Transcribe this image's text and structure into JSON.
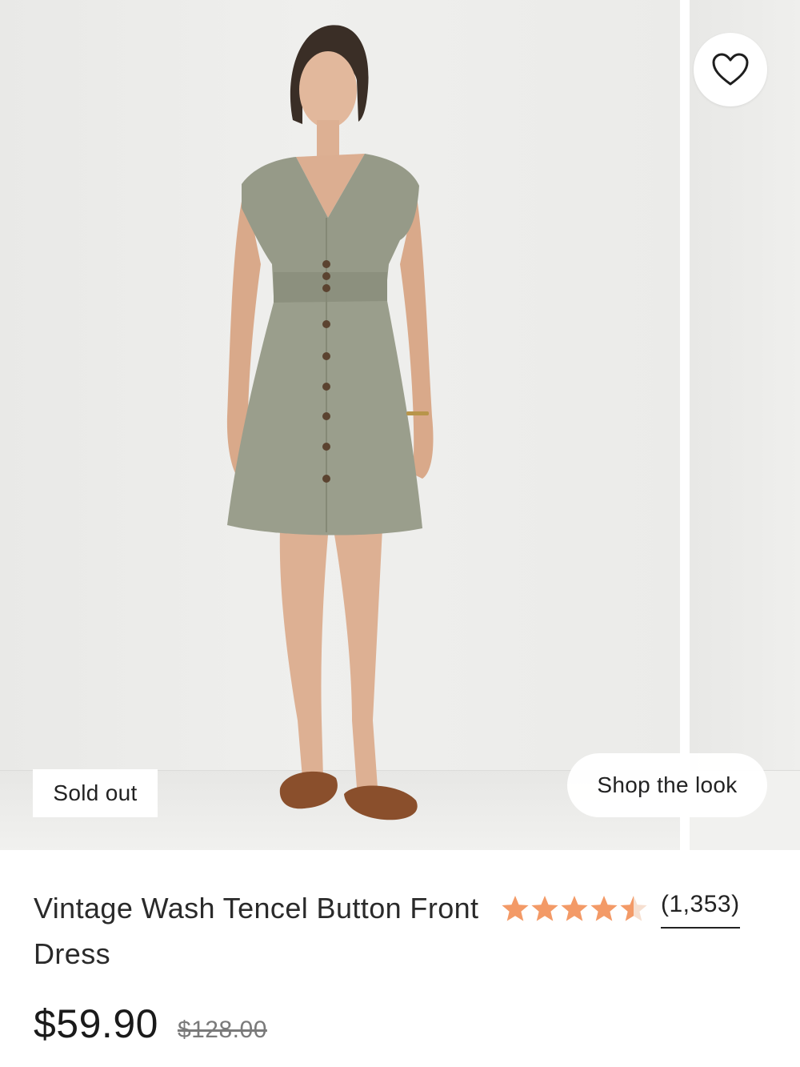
{
  "gallery": {
    "badge": "Sold out",
    "shop_look_label": "Shop the look",
    "favorite_icon": "heart-outline-icon"
  },
  "product": {
    "title": "Vintage Wash Tencel Button Front Dress",
    "rating": {
      "value": 4.5,
      "max": 5,
      "count_label": "(1,353)",
      "star_color": "#f39a67"
    },
    "price_current": "$59.90",
    "price_original": "$128.00"
  }
}
